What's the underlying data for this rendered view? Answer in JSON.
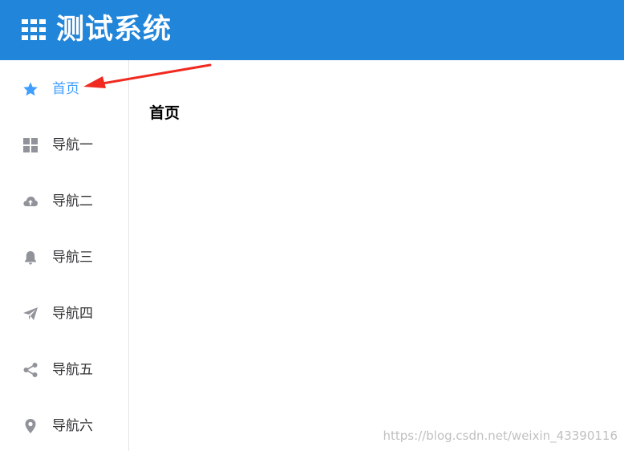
{
  "header": {
    "title": "测试系统",
    "icon": "grid-icon",
    "background": "#2185d9"
  },
  "sidebar": {
    "active_color": "#409eff",
    "items": [
      {
        "label": "首页",
        "icon": "star-icon",
        "active": true
      },
      {
        "label": "导航一",
        "icon": "grid-icon"
      },
      {
        "label": "导航二",
        "icon": "cloud-upload-icon"
      },
      {
        "label": "导航三",
        "icon": "bell-icon"
      },
      {
        "label": "导航四",
        "icon": "paper-plane-icon"
      },
      {
        "label": "导航五",
        "icon": "share-icon"
      },
      {
        "label": "导航六",
        "icon": "location-icon"
      }
    ]
  },
  "main": {
    "heading": "首页"
  },
  "annotation": {
    "arrow_color": "#f02a20"
  },
  "watermark": "https://blog.csdn.net/weixin_43390116"
}
